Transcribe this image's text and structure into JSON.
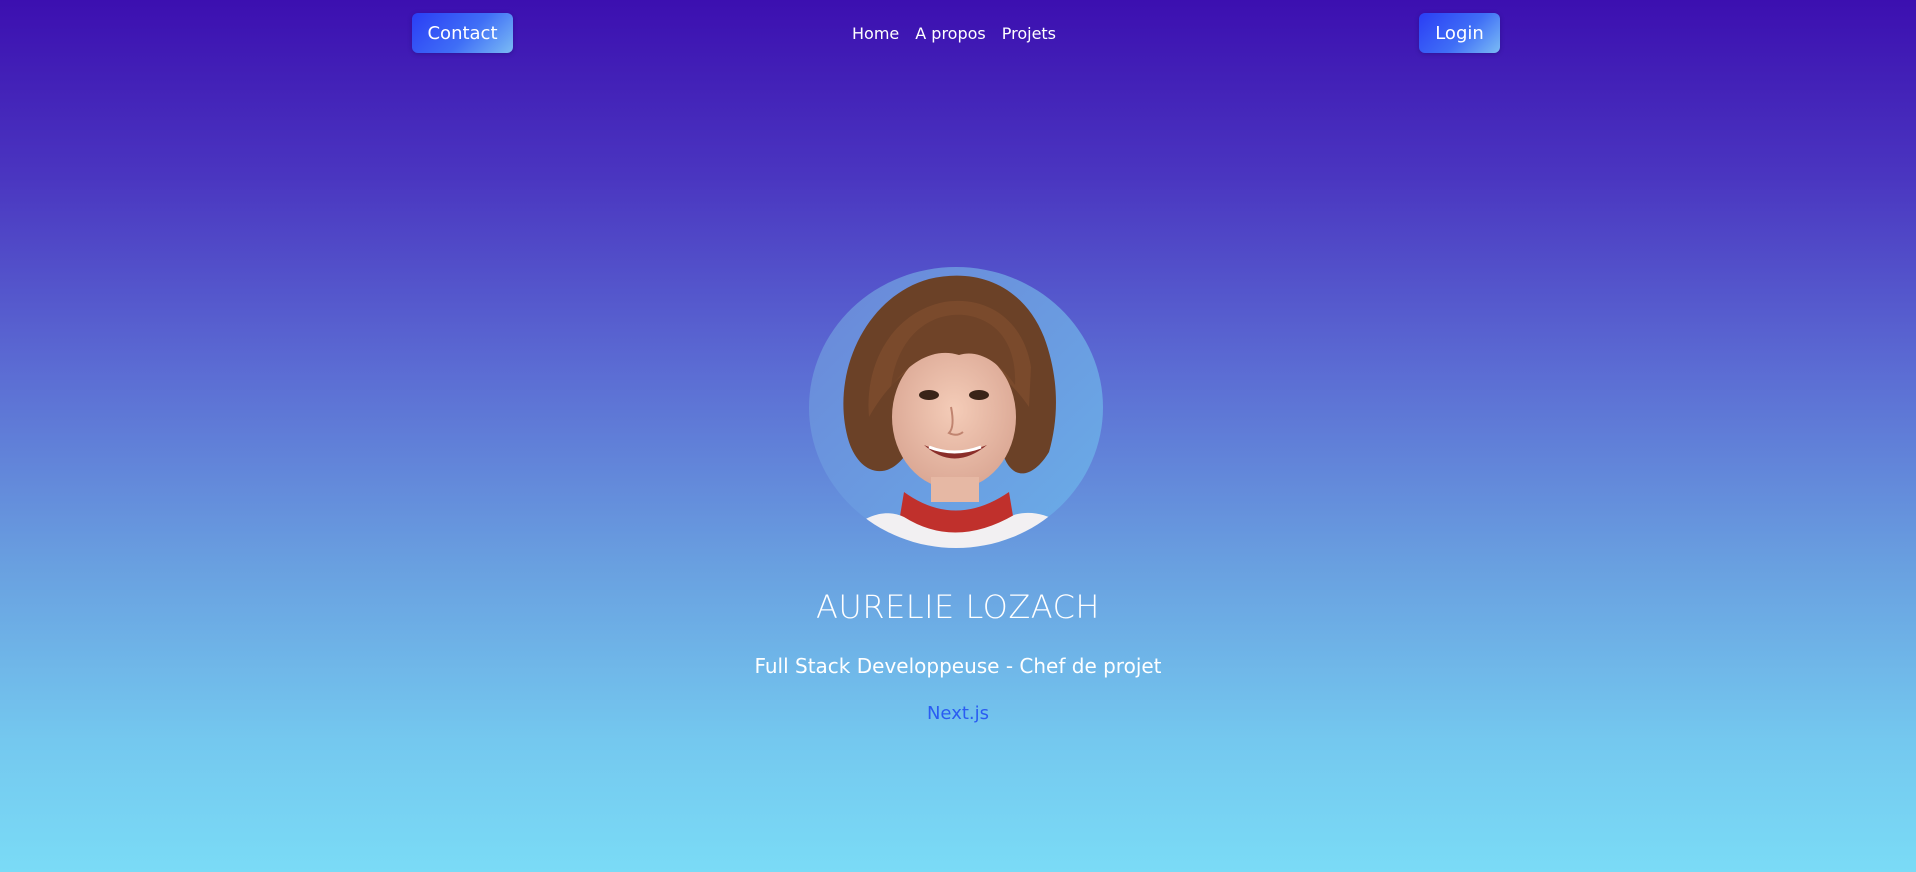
{
  "navbar": {
    "contact_label": "Contact",
    "login_label": "Login",
    "links": [
      {
        "label": "Home"
      },
      {
        "label": "A propos"
      },
      {
        "label": "Projets"
      }
    ]
  },
  "hero": {
    "photo_alt": "Photo portrait",
    "name": "AURELIE LOZACH",
    "subtitle": "Full Stack Developpeuse - Chef de projet",
    "tech": "Next.js"
  },
  "colors": {
    "gradient_top": "#3c0fb0",
    "gradient_bottom": "#7adbf6",
    "button_start": "#2a3df5",
    "button_end": "#7bbcf5",
    "tech_text": "#2a5cf2"
  }
}
